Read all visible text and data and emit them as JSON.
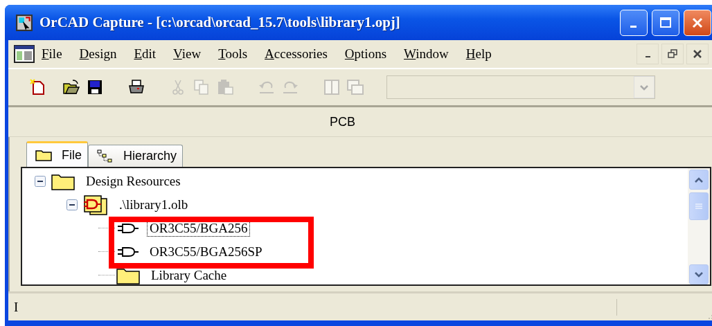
{
  "window": {
    "title": "OrCAD Capture - [c:\\orcad\\orcad_15.7\\tools\\library1.opj]"
  },
  "menu": [
    "File",
    "Design",
    "Edit",
    "View",
    "Tools",
    "Accessories",
    "Options",
    "Window",
    "Help"
  ],
  "toolbar": [
    {
      "kind": "new",
      "disabled": false
    },
    {
      "kind": "open",
      "disabled": false
    },
    {
      "kind": "save",
      "disabled": false
    },
    {
      "kind": "print",
      "disabled": false
    },
    {
      "kind": "cut",
      "disabled": true
    },
    {
      "kind": "copy",
      "disabled": true
    },
    {
      "kind": "paste",
      "disabled": true
    },
    {
      "kind": "undo",
      "disabled": true
    },
    {
      "kind": "redo",
      "disabled": true
    },
    {
      "kind": "tile",
      "disabled": true
    },
    {
      "kind": "cascade",
      "disabled": true
    }
  ],
  "combo": {
    "disabled": true
  },
  "panel_title": "PCB",
  "tabs": [
    {
      "label": "File",
      "kind": "folder",
      "selected": true
    },
    {
      "label": "Hierarchy",
      "kind": "hierarchy",
      "selected": false
    }
  ],
  "tree": [
    {
      "label": "Design Resources",
      "kind": "folder",
      "expanded": true,
      "selected": false,
      "children": [
        {
          "label": ".\\library1.olb",
          "kind": "library",
          "expanded": true,
          "selected": false,
          "children": [
            {
              "label": "OR3C55/BGA256",
              "kind": "part",
              "selected": true
            },
            {
              "label": "OR3C55/BGA256SP",
              "kind": "part",
              "selected": false
            },
            {
              "label": "Library Cache",
              "kind": "folder",
              "selected": false
            }
          ]
        }
      ]
    }
  ],
  "status_bar": {
    "text": "I"
  }
}
